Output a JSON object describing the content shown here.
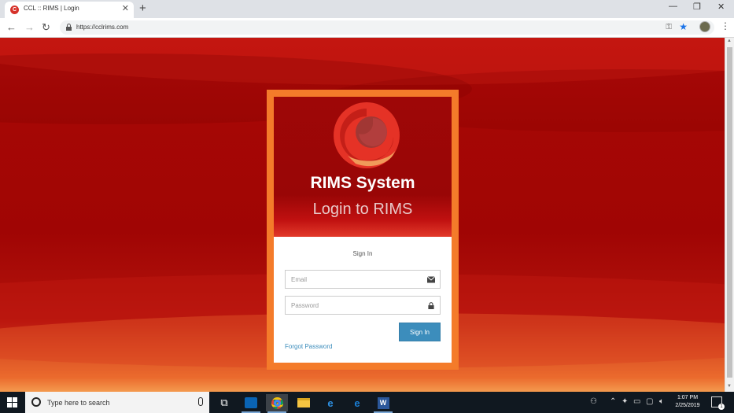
{
  "browser": {
    "tab_title": "CCL :: RIMS | Login",
    "url": "https://cclrims.com"
  },
  "login": {
    "app_name": "RIMS System",
    "heading": "Login to RIMS",
    "sign_in_title": "Sign In",
    "email_placeholder": "Email",
    "password_placeholder": "Password",
    "sign_in_button": "Sign In",
    "forgot_password": "Forgot Password"
  },
  "taskbar": {
    "search_placeholder": "Type here to search",
    "time": "1:07 PM",
    "date": "2/25/2019",
    "notification_count": "1"
  },
  "colors": {
    "card_border": "#f47b2a",
    "header_red": "#9e0707",
    "button_blue": "#3c8dbc"
  }
}
